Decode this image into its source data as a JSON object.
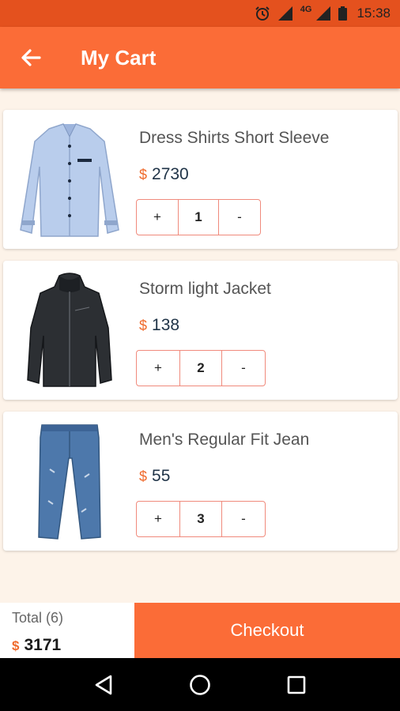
{
  "status_bar": {
    "time": "15:38",
    "network": "4G",
    "icons": [
      "alarm-icon",
      "signal-icon",
      "battery-icon"
    ]
  },
  "app_bar": {
    "title": "My Cart",
    "back_icon": "arrow-left-icon"
  },
  "items": [
    {
      "name": "Dress Shirts Short Sleeve",
      "currency": "$",
      "price": "2730",
      "plus": "+",
      "qty": "1",
      "minus": "-",
      "image": "shirt-image"
    },
    {
      "name": "Storm light Jacket",
      "currency": "$",
      "price": "138",
      "plus": "+",
      "qty": "2",
      "minus": "-",
      "image": "jacket-image"
    },
    {
      "name": "Men's Regular Fit Jean",
      "currency": "$",
      "price": "55",
      "plus": "+",
      "qty": "3",
      "minus": "-",
      "image": "jeans-image"
    }
  ],
  "footer": {
    "total_label": "Total (6)",
    "currency": "$",
    "total": "3171",
    "checkout_label": "Checkout"
  },
  "colors": {
    "primary": "#fb6c37",
    "status": "#e4511e",
    "accent": "#ef6a2c",
    "background": "#fdf3e9",
    "stepper_border": "#f08a7c"
  }
}
